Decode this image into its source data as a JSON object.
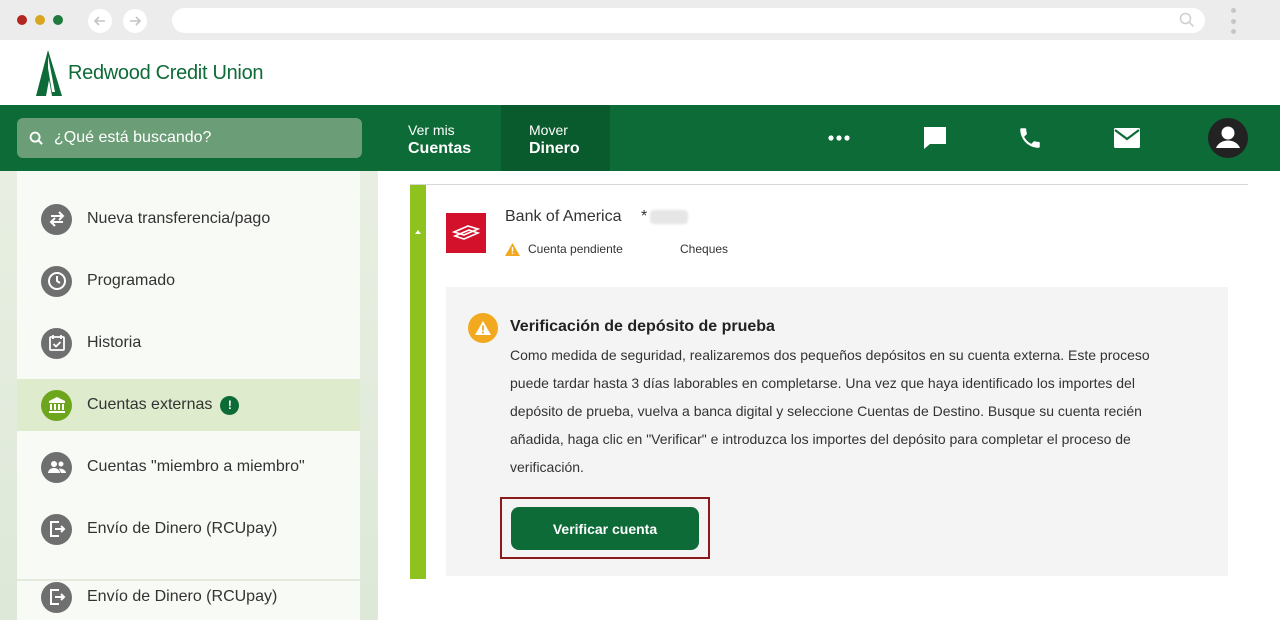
{
  "colors": {
    "brand_green": "#0c6b37",
    "active_tab_green": "#095a2d",
    "accent_lime": "#8dc21f",
    "warning_orange": "#f2a91f",
    "bank_red": "#d3112a",
    "highlight_border": "#8b1a1a"
  },
  "browser": {
    "icons": [
      "back-arrow-icon",
      "forward-arrow-icon",
      "search-icon",
      "kebab-menu-icon"
    ]
  },
  "brand": {
    "name": "Redwood Credit Union",
    "logo_icon": "redwood-tree-logo"
  },
  "header": {
    "search_placeholder": "¿Qué está buscando?",
    "tabs": [
      {
        "line1": "Ver mis",
        "line2": "Cuentas"
      },
      {
        "line1": "Mover",
        "line2": "Dinero"
      }
    ],
    "icons": [
      "more-icon",
      "chat-icon",
      "phone-icon",
      "mail-icon",
      "user-avatar-icon"
    ]
  },
  "sidebar": {
    "items": [
      {
        "label": "Nueva transferencia/pago",
        "icon": "transfer-arrows-icon"
      },
      {
        "label": "Programado",
        "icon": "clock-icon"
      },
      {
        "label": "Historia",
        "icon": "calendar-check-icon"
      },
      {
        "label": "Cuentas externas",
        "icon": "bank-icon",
        "badge": "!"
      },
      {
        "label": "Cuentas \"miembro a miembro\"",
        "icon": "people-icon"
      },
      {
        "label": "Envío de Dinero (RCUpay)",
        "icon": "send-money-icon"
      },
      {
        "label": "Envío de Dinero (RCUpay)",
        "icon": "send-money-icon"
      }
    ]
  },
  "account": {
    "bank_name": "Bank of America",
    "mask": "*",
    "status": "Cuenta pendiente",
    "type": "Cheques"
  },
  "verification": {
    "title": "Verificación de depósito de prueba",
    "body": "Como medida de seguridad, realizaremos dos pequeños depósitos en su cuenta externa. Este proceso puede tardar hasta 3 días laborables en completarse. Una vez que haya identificado los importes del depósito de prueba, vuelva a banca digital y seleccione Cuentas de Destino. Busque su cuenta recién añadida, haga clic en \"Verificar\" e introduzca los importes del depósito para completar el proceso de verificación.",
    "button_label": "Verificar cuenta"
  }
}
